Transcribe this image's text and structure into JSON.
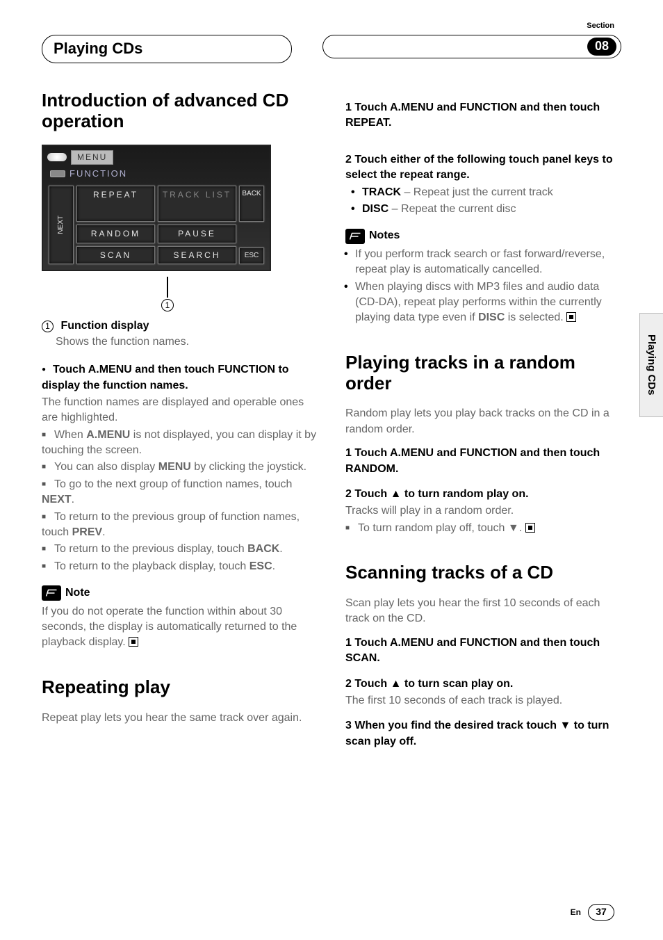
{
  "header": {
    "section_label": "Section",
    "title": "Playing CDs",
    "badge": "08"
  },
  "side_tab": "Playing CDs",
  "device": {
    "menu": "MENU",
    "sub": "FUNCTION",
    "buttons": {
      "repeat": "REPEAT",
      "tracklist": "TRACK LIST",
      "random": "RANDOM",
      "pause": "PAUSE",
      "scan": "SCAN",
      "search": "SEARCH",
      "next": "NEXT",
      "back": "BACK",
      "esc": "ESC"
    },
    "callout_num": "1"
  },
  "left": {
    "h2": "Introduction of advanced CD operation",
    "fn_label": "Function display",
    "fn_desc": "Shows the function names.",
    "lead_heading": "Touch A.MENU and then touch FUNCTION to display the function names.",
    "lead_body": "The function names are displayed and operable ones are highlighted.",
    "tips": {
      "t1a": "When ",
      "t1b": "A.MENU",
      "t1c": " is not displayed, you can display it by touching the screen.",
      "t2a": "You can also display ",
      "t2b": "MENU",
      "t2c": " by clicking the joystick.",
      "t3a": "To go to the next group of function names, touch ",
      "t3b": "NEXT",
      "t3c": ".",
      "t4a": "To return to the previous group of function names, touch ",
      "t4b": "PREV",
      "t4c": ".",
      "t5a": "To return to the previous display, touch ",
      "t5b": "BACK",
      "t5c": ".",
      "t6a": "To return to the playback display, touch ",
      "t6b": "ESC",
      "t6c": "."
    },
    "note_label": "Note",
    "note_body": "If you do not operate the function within about 30 seconds, the display is automatically returned to the playback display.",
    "repeat_h2": "Repeating play",
    "repeat_body": "Repeat play lets you hear the same track over again."
  },
  "right": {
    "step1": "1   Touch A.MENU and FUNCTION and then touch REPEAT.",
    "step2": "2   Touch either of the following touch panel keys to select the repeat range.",
    "opt_track_b": "TRACK",
    "opt_track_t": " – Repeat just the current track",
    "opt_disc_b": "DISC",
    "opt_disc_t": " – Repeat the current disc",
    "notes_label": "Notes",
    "note1": "If you perform track search or fast forward/reverse, repeat play is automatically cancelled.",
    "note2a": "When playing discs with MP3 files and audio data (CD-DA), repeat play performs within the currently playing data type even if ",
    "note2b": "DISC",
    "note2c": " is selected.",
    "rand_h2": "Playing tracks in a random order",
    "rand_body": "Random play lets you play back tracks on the CD in a random order.",
    "rand_s1": "1   Touch A.MENU and FUNCTION and then touch RANDOM.",
    "rand_s2": "2   Touch ▲ to turn random play on.",
    "rand_s2_body": "Tracks will play in a random order.",
    "rand_off": "To turn random play off, touch ▼.",
    "scan_h2": "Scanning tracks of a CD",
    "scan_body": "Scan play lets you hear the first 10 seconds of each track on the CD.",
    "scan_s1": "1   Touch A.MENU and FUNCTION and then touch SCAN.",
    "scan_s2": "2   Touch ▲ to turn scan play on.",
    "scan_s2_body": "The first 10 seconds of each track is played.",
    "scan_s3": "3   When you find the desired track touch ▼ to turn scan play off."
  },
  "footer": {
    "lang": "En",
    "page": "37"
  }
}
